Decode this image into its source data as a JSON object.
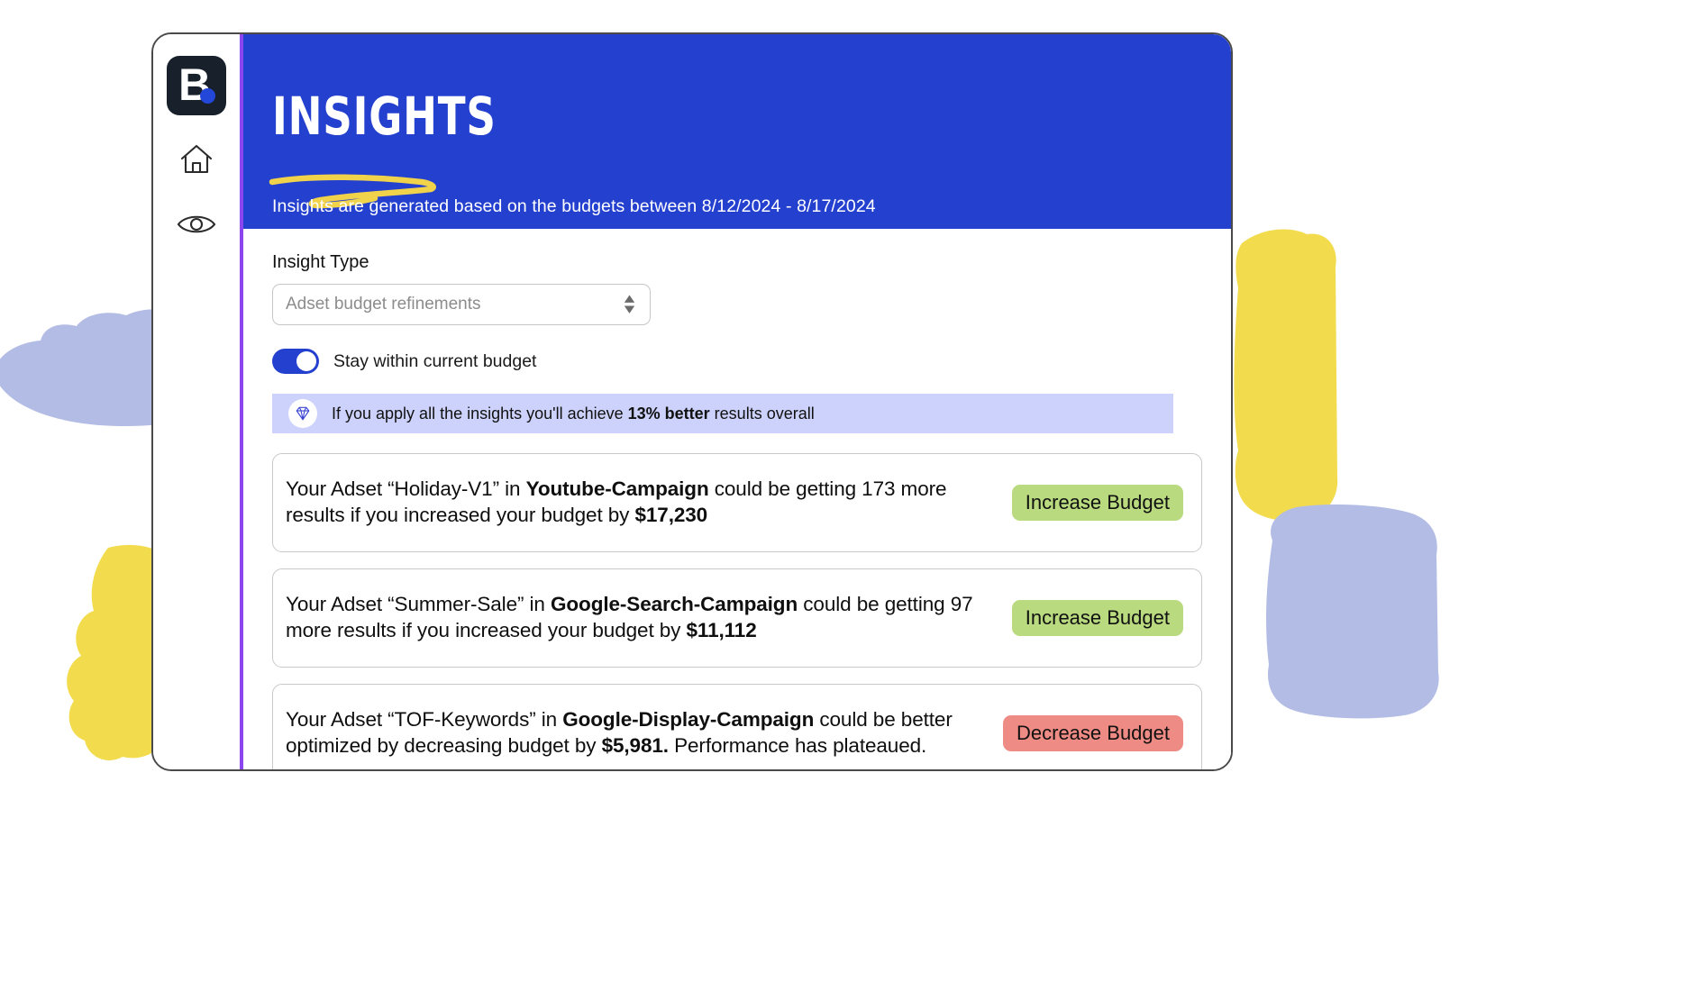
{
  "window": {
    "accent_bar_color": "#8b46f0",
    "brand": {
      "mark": "B",
      "dot_color": "#2347d9",
      "name": "brand-logo"
    }
  },
  "sidebar": {
    "items": [
      {
        "icon": "home-icon",
        "label": "Home"
      },
      {
        "icon": "eye-icon",
        "label": "Overview"
      }
    ]
  },
  "header": {
    "background_color": "#2440cf",
    "wordmark": "INSIGHTS",
    "underline_color": "#f0d24b",
    "subtitle": "Insights are generated based on the budgets between 8/12/2024 - 8/17/2024",
    "date_range_start": "8/12/2024",
    "date_range_end": "8/17/2024"
  },
  "controls": {
    "insight_type_label": "Insight Type",
    "insight_type_value": "Adset budget refinements",
    "insight_type_placeholder": "Adset budget refinements",
    "toggle_label": "Stay within current budget",
    "toggle_on": true,
    "toggle_on_color": "#2440cf"
  },
  "banner": {
    "icon": "diamond-icon",
    "background_color": "#ccd2fb",
    "text_before": "If you apply all the insights you'll achieve ",
    "highlight": "13% better",
    "text_after": " results overall",
    "improvement_percent": "13%"
  },
  "cards": [
    {
      "line1_prefix": "Your Adset “Holiday-V1” in ",
      "campaign": "Youtube-Campaign",
      "line1_suffix": " could be getting 173 more",
      "line2_prefix": "results if you increased your budget by ",
      "amount": "$17,230",
      "line2_suffix": "",
      "adset": "Holiday-V1",
      "extra_results": "173",
      "badge_label": "Increase Budget",
      "badge_type": "increase",
      "badge_color": "#b9da7e"
    },
    {
      "line1_prefix": "Your Adset “Summer-Sale” in ",
      "campaign": "Google-Search-Campaign",
      "line1_suffix": " could be",
      "line2_prefix": "getting 97 more results if you increased your budget by ",
      "amount": "$11,112",
      "line2_suffix": "",
      "adset": "Summer-Sale",
      "extra_results": "97",
      "badge_label": "Increase Budget",
      "badge_type": "increase",
      "badge_color": "#b9da7e"
    },
    {
      "line1_prefix": "Your Adset “TOF-Keywords” in ",
      "campaign": "Google-Display-Campaign",
      "line1_suffix": " could be better",
      "line2_prefix": "optimized by decreasing budget by ",
      "amount": "$5,981.",
      "line2_suffix": " Performance has plateaued.",
      "adset": "TOF-Keywords",
      "extra_results": "",
      "badge_label": "Decrease Budget",
      "badge_type": "decrease",
      "badge_color": "#ee8b84"
    }
  ],
  "decorations": {
    "blue_color": "#b3bce4",
    "yellow_color": "#f2dc4e"
  }
}
